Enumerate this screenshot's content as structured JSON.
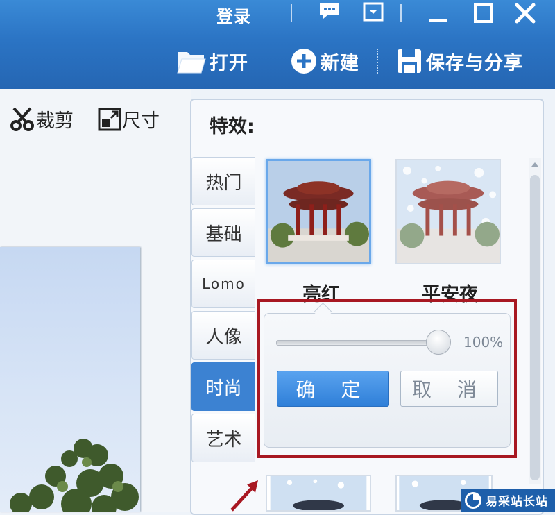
{
  "titlebar": {
    "login_label": "登录",
    "icons": [
      "chat-icon",
      "skin-icon",
      "minimize-icon",
      "maximize-icon",
      "close-icon"
    ]
  },
  "toolbar": {
    "open_label": "打开",
    "new_label": "新建",
    "save_label": "保存与分享"
  },
  "edit_tools": {
    "crop_label": "裁剪",
    "size_label": "尺寸"
  },
  "effects_panel": {
    "title": "特效:",
    "categories": [
      "热门",
      "基础",
      "Lomo",
      "人像",
      "时尚",
      "艺术"
    ],
    "active_category": "时尚",
    "effects": [
      {
        "label": "亮红",
        "selected": true
      },
      {
        "label": "平安夜",
        "selected": false
      }
    ],
    "popup": {
      "intensity": "100%",
      "confirm_label": "确 定",
      "cancel_label": "取 消"
    }
  },
  "watermark": {
    "text": "易采站长站"
  },
  "colors": {
    "titlebar": "#2b74c4",
    "accent": "#3c82d2",
    "highlight": "#a81822"
  }
}
